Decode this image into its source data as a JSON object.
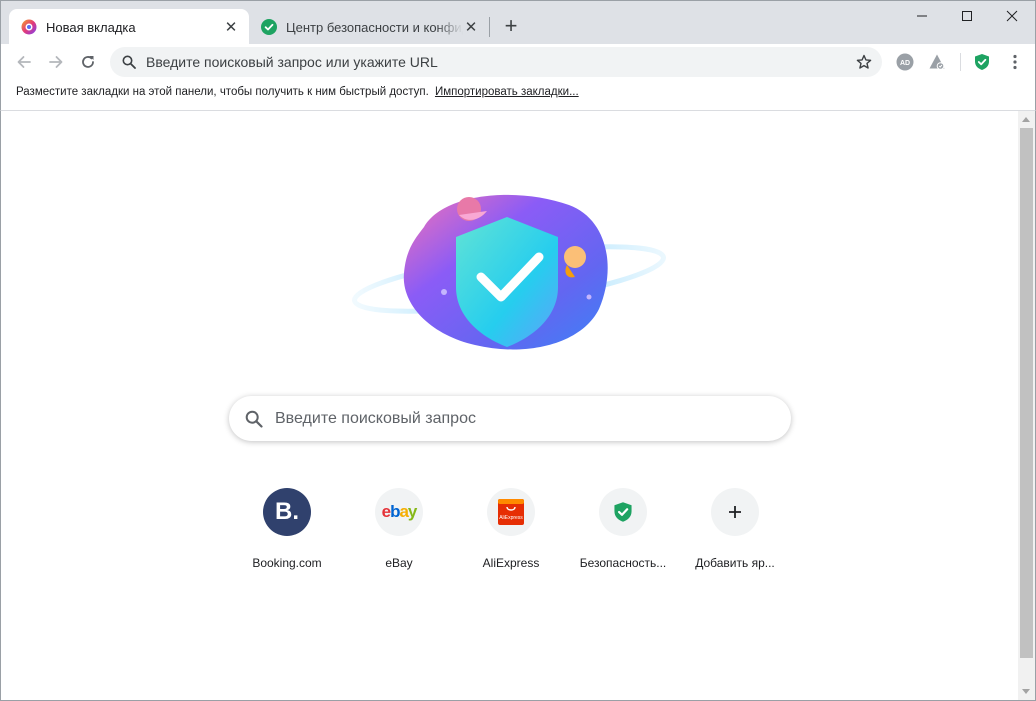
{
  "tabs": [
    {
      "label": "Новая вкладка",
      "icon": "browser-logo-icon",
      "active": true
    },
    {
      "label": "Центр безопасности и конфиденциальности",
      "icon": "shield-check-icon",
      "active": false
    }
  ],
  "new_tab_symbol": "+",
  "window_controls": [
    "minimize-icon",
    "maximize-icon",
    "close-icon"
  ],
  "toolbar": {
    "omnibox_placeholder": "Введите поисковый запрос или укажите URL",
    "extensions": [
      "adblock-icon",
      "privacy-extension-icon",
      "security-shield-icon",
      "menu-kebab-icon"
    ]
  },
  "bookmarks_bar": {
    "message": "Разместите закладки на этой панели, чтобы получить к ним быстрый доступ.",
    "import_link": "Импортировать закладки..."
  },
  "search": {
    "placeholder": "Введите поисковый запрос"
  },
  "shortcuts": [
    {
      "name": "Booking.com",
      "icon": "booking-logo-icon"
    },
    {
      "name": "eBay",
      "icon": "ebay-logo-icon"
    },
    {
      "name": "AliExpress",
      "icon": "aliexpress-logo-icon",
      "logo_text": "AliExpress"
    },
    {
      "name": "Безопасность...",
      "icon": "security-shield-icon"
    },
    {
      "name": "Добавить яр...",
      "icon": "plus-icon"
    }
  ],
  "logos": {
    "booking": "B.",
    "ebay": [
      "e",
      "b",
      "a",
      "y"
    ]
  },
  "colors": {
    "accent_green": "#1ea362",
    "booking_navy": "#30416d",
    "aliexpress_red": "#e62e04",
    "titlebar_bg": "#dee1e6"
  }
}
